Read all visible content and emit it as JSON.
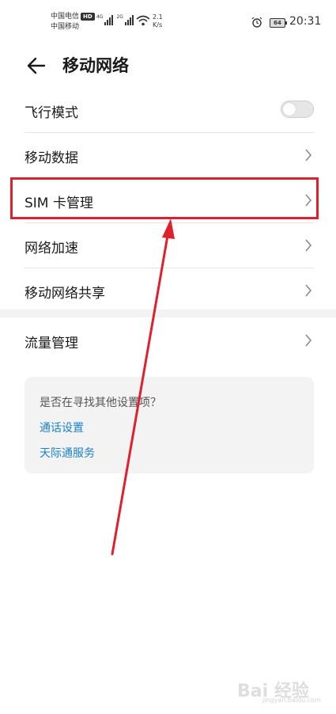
{
  "status_bar": {
    "carrier1": "中国电信",
    "carrier2": "中国移动",
    "hd_badge": "HD",
    "sig1_label": "4G",
    "sig2_label": "2G",
    "speed_value": "2.1",
    "speed_unit": "K/s",
    "battery": "64",
    "time": "20:31"
  },
  "header": {
    "title": "移动网络"
  },
  "settings": {
    "items": [
      {
        "label": "飞行模式",
        "type": "toggle",
        "on": false
      },
      {
        "label": "移动数据",
        "type": "nav"
      },
      {
        "label": "SIM 卡管理",
        "type": "nav",
        "highlighted": true
      },
      {
        "label": "网络加速",
        "type": "nav"
      },
      {
        "label": "移动网络共享",
        "type": "nav"
      }
    ],
    "items2": [
      {
        "label": "流量管理",
        "type": "nav"
      }
    ]
  },
  "suggestions": {
    "question": "是否在寻找其他设置项？",
    "links": [
      "通话设置",
      "天际通服务"
    ]
  },
  "annotation": {
    "color": "#e0202c"
  },
  "watermark": {
    "brand": "Bai 经验",
    "url": "jingyan.baidu.com"
  },
  "colors": {
    "link": "#1b82c8",
    "highlight": "#e0202c"
  }
}
